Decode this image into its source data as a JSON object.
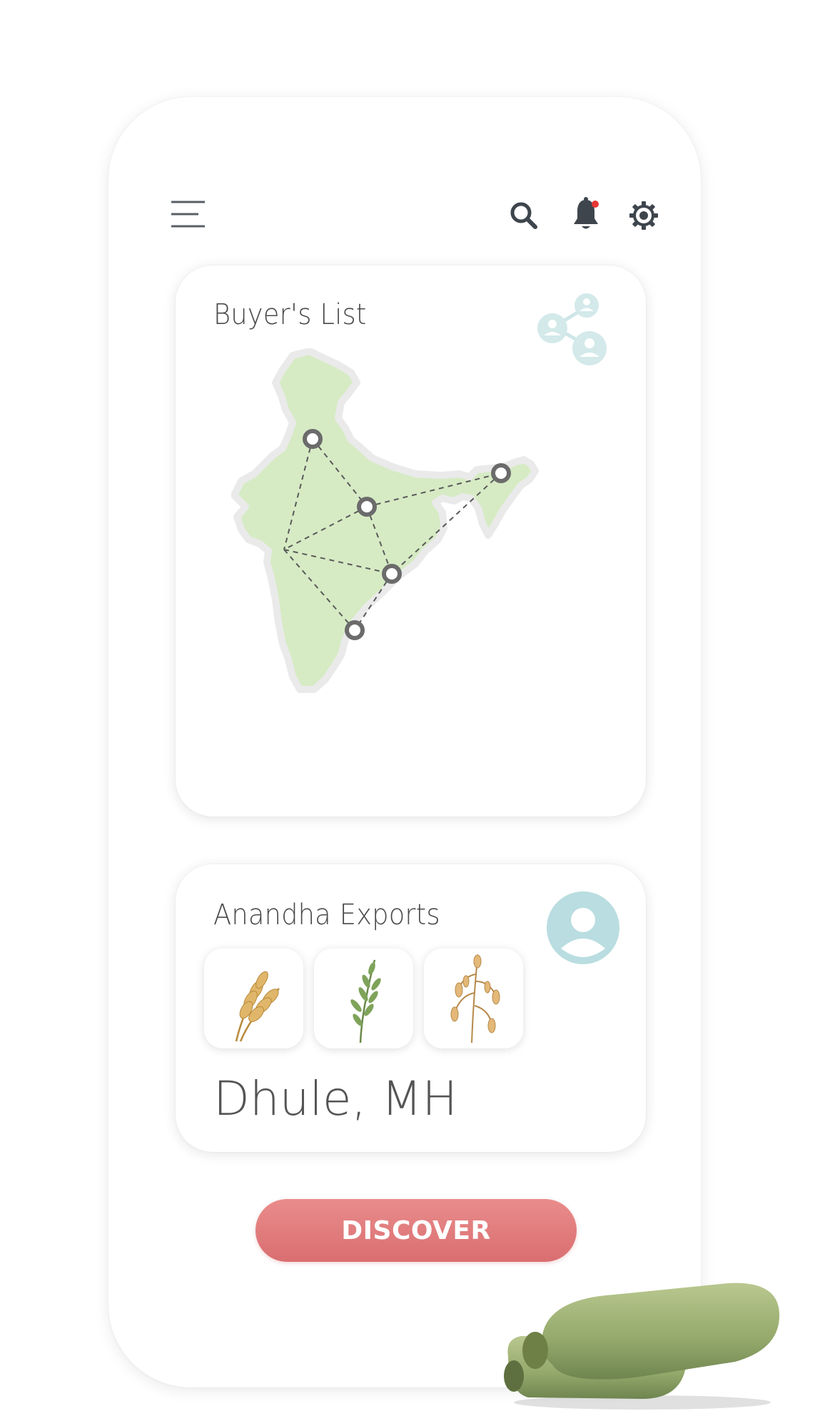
{
  "header": {
    "menu_icon": "menu-icon",
    "search_icon": "search-icon",
    "notification_icon": "bell-icon",
    "notification_dot_color": "#e53935",
    "settings_icon": "gear-icon"
  },
  "buyers_card": {
    "title": "Buyer's List",
    "share_icon": "share-network-icon",
    "map": "india-map",
    "map_color": "#d6ebc4",
    "node_count": 5
  },
  "exporter_card": {
    "name": "Anandha Exports",
    "avatar_icon": "user-avatar-icon",
    "avatar_color": "#b9dde0",
    "crops": [
      {
        "name": "wheat-icon"
      },
      {
        "name": "millet-icon"
      },
      {
        "name": "oats-icon"
      }
    ],
    "location": "Dhule, MH"
  },
  "discover_button": {
    "label": "DISCOVER",
    "color": "#e07a7b"
  },
  "decoration": "zucchini-image"
}
